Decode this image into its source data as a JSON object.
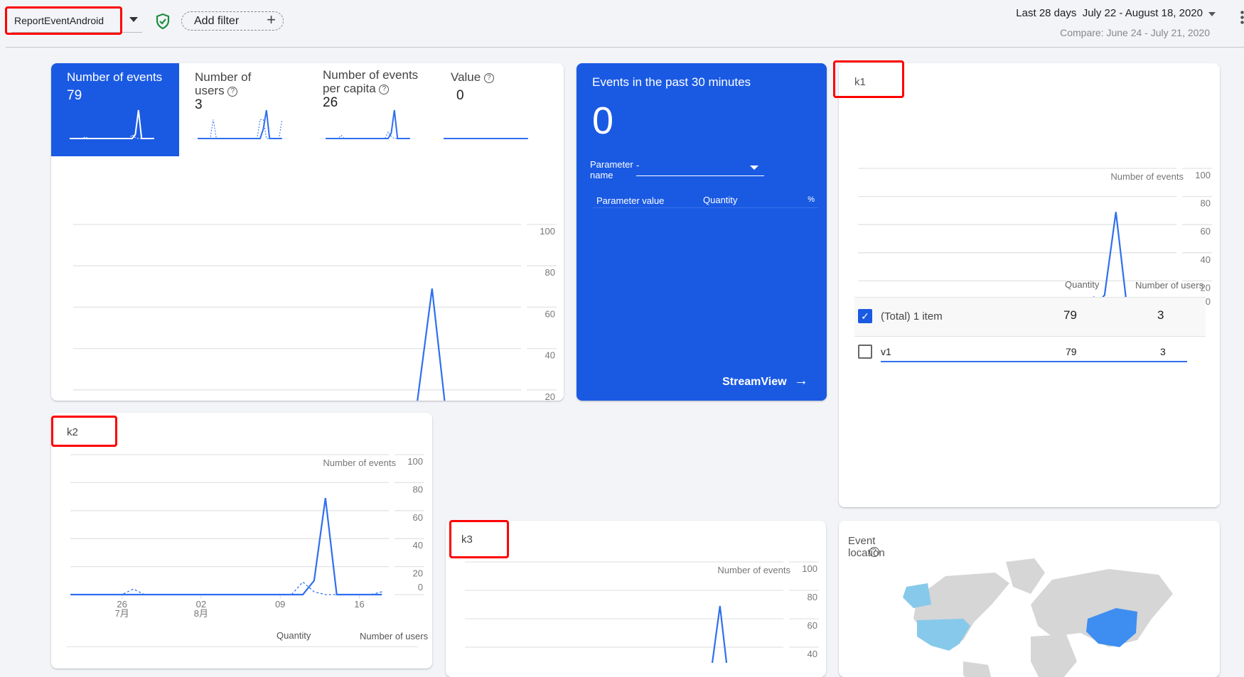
{
  "topbar": {
    "property": "ReportEventAndroid",
    "add_filter": "Add filter",
    "date_preset": "Last 28 days",
    "date_range": "July 22 - August 18, 2020",
    "compare": "Compare: June 24 - July 21, 2020"
  },
  "colors": {
    "accent": "#1a5ae3",
    "line": "#2f6ff0",
    "highlight": "#ff0000",
    "shield": "#1e8e3e",
    "map_high": "#3d8ef0",
    "map_low": "#87c9ea",
    "map_none": "#d6d6d6"
  },
  "metrics": [
    {
      "label": "Number of events",
      "value": "79",
      "active": true
    },
    {
      "label": "Number of users",
      "value": "3",
      "active": false
    },
    {
      "label": "Number of events per capita",
      "value": "26",
      "active": false
    },
    {
      "label": "Value",
      "value": "0",
      "active": false
    }
  ],
  "realtime": {
    "title": "Events in the past 30 minutes",
    "value": "0",
    "param_label": "Parameter name",
    "param_value": "-",
    "col_value": "Parameter value",
    "col_qty": "Quantity",
    "col_pct": "%",
    "link": "StreamView"
  },
  "k1": {
    "title": "k1",
    "col_qty": "Quantity",
    "col_users": "Number of users",
    "rows": [
      {
        "label": "(Total) 1 item",
        "qty": "79",
        "users": "3",
        "checked": true
      },
      {
        "label": "v1",
        "qty": "79",
        "users": "3",
        "checked": false
      }
    ]
  },
  "k2": {
    "title": "k2",
    "col_qty": "Quantity",
    "col_users": "Number of users"
  },
  "k3": {
    "title": "k3"
  },
  "map": {
    "title": "Event location",
    "icon": "help-icon",
    "highlighted": [
      "China",
      "United States"
    ]
  },
  "chart_data": [
    {
      "type": "line",
      "ylabel": "",
      "ylim": [
        0,
        100
      ],
      "yticks": [
        "100",
        "80",
        "60",
        "40",
        "20",
        "0"
      ],
      "xticks": [
        {
          "day": "26",
          "month": "7月"
        },
        {
          "day": "02",
          "month": "8月"
        },
        {
          "day": "09",
          "month": ""
        },
        {
          "day": "16",
          "month": ""
        }
      ],
      "x": [
        "07-22",
        "07-23",
        "07-24",
        "07-25",
        "07-26",
        "07-27",
        "07-28",
        "07-29",
        "07-30",
        "07-31",
        "08-01",
        "08-02",
        "08-03",
        "08-04",
        "08-05",
        "08-06",
        "08-07",
        "08-08",
        "08-09",
        "08-10",
        "08-11",
        "08-12",
        "08-13",
        "08-14",
        "08-15",
        "08-16",
        "08-17",
        "08-18"
      ],
      "series": [
        {
          "values": [
            0,
            0,
            0,
            0,
            0,
            0,
            0,
            0,
            0,
            0,
            0,
            0,
            0,
            0,
            0,
            0,
            0,
            0,
            0,
            0,
            0,
            10,
            69,
            0,
            0,
            0,
            0,
            0
          ],
          "style": "solid"
        },
        {
          "values": [
            0,
            0,
            0,
            0,
            0,
            4,
            0,
            0,
            0,
            0,
            0,
            0,
            0,
            0,
            0,
            0,
            0,
            0,
            0,
            0,
            9,
            2,
            0,
            0,
            0,
            0,
            0,
            2
          ],
          "style": "dashed"
        }
      ]
    },
    {
      "type": "line",
      "title": "k1",
      "ylabel": "Number of events",
      "ylim": [
        0,
        100
      ],
      "yticks": [
        "100",
        "80",
        "60",
        "40",
        "20",
        "0"
      ]
    },
    {
      "type": "line",
      "title": "k2",
      "ylabel": "Number of events",
      "ylim": [
        0,
        100
      ],
      "yticks": [
        "100",
        "80",
        "60",
        "40",
        "20",
        "0"
      ]
    },
    {
      "type": "line",
      "title": "k3",
      "ylabel": "Number of events",
      "ylim": [
        0,
        100
      ],
      "yticks": [
        "100",
        "80",
        "60",
        "40"
      ]
    }
  ],
  "sparklines": [
    {
      "current": [
        0,
        0,
        0,
        0,
        0,
        0,
        0,
        0,
        0,
        0,
        0,
        0,
        0,
        0,
        0,
        0,
        0,
        0,
        0,
        0,
        0,
        10,
        69,
        0,
        0,
        0,
        0,
        0
      ],
      "compare": [
        0,
        0,
        0,
        0,
        0,
        4,
        0,
        0,
        0,
        0,
        0,
        0,
        0,
        0,
        0,
        0,
        0,
        0,
        0,
        0,
        9,
        2,
        0,
        0,
        0,
        0,
        0,
        2
      ]
    },
    {
      "current": [
        0,
        0,
        0,
        0,
        0,
        0,
        0,
        0,
        0,
        0,
        0,
        0,
        0,
        0,
        0,
        0,
        0,
        0,
        0,
        0,
        0,
        1,
        3,
        0,
        0,
        0,
        0,
        0
      ],
      "compare": [
        0,
        0,
        0,
        0,
        0,
        2,
        0,
        0,
        0,
        0,
        0,
        0,
        0,
        0,
        0,
        0,
        0,
        0,
        0,
        0,
        2,
        2,
        0,
        0,
        0,
        0,
        0,
        2
      ]
    },
    {
      "current": [
        0,
        0,
        0,
        0,
        0,
        0,
        0,
        0,
        0,
        0,
        0,
        0,
        0,
        0,
        0,
        0,
        0,
        0,
        0,
        0,
        0,
        5,
        26,
        0,
        0,
        0,
        0,
        0
      ],
      "compare": [
        0,
        0,
        0,
        0,
        0,
        3,
        0,
        0,
        0,
        0,
        0,
        0,
        0,
        0,
        0,
        0,
        0,
        0,
        0,
        0,
        6,
        2,
        0,
        0,
        0,
        0,
        0,
        0
      ]
    },
    {
      "current": [
        0,
        0,
        0,
        0,
        0,
        0,
        0,
        0,
        0,
        0,
        0,
        0,
        0,
        0,
        0,
        0,
        0,
        0,
        0,
        0,
        0,
        0,
        0,
        0,
        0,
        0,
        0,
        0
      ],
      "compare": [
        0,
        0,
        0,
        0,
        0,
        0,
        0,
        0,
        0,
        0,
        0,
        0,
        0,
        0,
        0,
        0,
        0,
        0,
        0,
        0,
        0,
        0,
        0,
        0,
        0,
        0,
        0,
        0
      ]
    }
  ]
}
